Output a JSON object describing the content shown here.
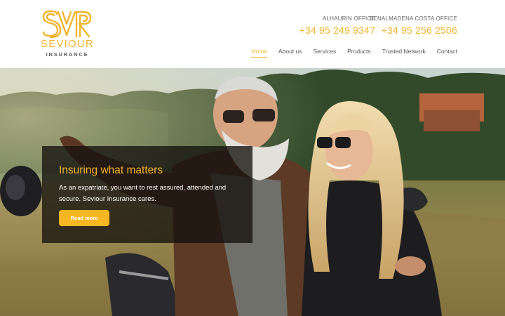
{
  "brand": {
    "logo_mark": "SVR",
    "name": "SEVIOUR",
    "tagline": "INSURANCE",
    "accent_color": "#f2b42c"
  },
  "offices": [
    {
      "label": "ALHAURIN OFFICE",
      "phone": "+34 95 249 9347"
    },
    {
      "label": "BENALMADENA COSTA OFFICE",
      "phone": "+34 95 256 2506"
    }
  ],
  "nav": {
    "items": [
      {
        "label": "Home",
        "active": true
      },
      {
        "label": "About us",
        "active": false
      },
      {
        "label": "Services",
        "active": false
      },
      {
        "label": "Products",
        "active": false
      },
      {
        "label": "Trusted Network",
        "active": false
      },
      {
        "label": "Contact",
        "active": false
      }
    ]
  },
  "hero": {
    "title": "Insuring what matters",
    "text": "As an expatriate, you want to rest assured, attended and secure. Seviour Insurance cares.",
    "button_label": "Read more",
    "button_color": "#f7b722"
  }
}
